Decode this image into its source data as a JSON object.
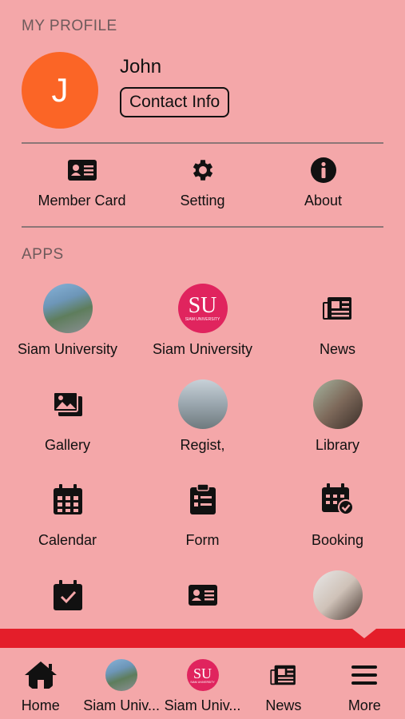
{
  "profile": {
    "section_title": "MY PROFILE",
    "avatar_initial": "J",
    "name": "John",
    "contact_button": "Contact Info"
  },
  "quick_actions": [
    {
      "label": "Member Card",
      "icon": "id-card-icon"
    },
    {
      "label": "Setting",
      "icon": "gear-icon"
    },
    {
      "label": "About",
      "icon": "info-icon"
    }
  ],
  "apps": {
    "section_title": "APPS",
    "items": [
      {
        "label": "Siam University",
        "icon": "campus-photo"
      },
      {
        "label": "Siam University",
        "icon": "su-logo"
      },
      {
        "label": "News",
        "icon": "newspaper-icon"
      },
      {
        "label": "Gallery",
        "icon": "gallery-icon"
      },
      {
        "label": "Regist,",
        "icon": "building-photo"
      },
      {
        "label": "Library",
        "icon": "person-photo"
      },
      {
        "label": "Calendar",
        "icon": "calendar-icon"
      },
      {
        "label": "Form",
        "icon": "form-icon"
      },
      {
        "label": "Booking",
        "icon": "booking-icon"
      },
      {
        "label": "",
        "icon": "calendar-check-icon"
      },
      {
        "label": "",
        "icon": "id-card-icon"
      },
      {
        "label": "",
        "icon": "person-photo"
      }
    ]
  },
  "su_logo": {
    "text": "SU",
    "subtext": "SIAM UNIVERSITY"
  },
  "bottom_nav": [
    {
      "label": "Home",
      "icon": "home-icon"
    },
    {
      "label": "Siam Univ...",
      "icon": "campus-photo"
    },
    {
      "label": "Siam Univ...",
      "icon": "su-logo"
    },
    {
      "label": "News",
      "icon": "newspaper-icon"
    },
    {
      "label": "More",
      "icon": "menu-icon"
    }
  ],
  "colors": {
    "background": "#f4a7a9",
    "avatar": "#fb6526",
    "accent_bar": "#e41e2a",
    "su_logo": "#e0245e"
  }
}
